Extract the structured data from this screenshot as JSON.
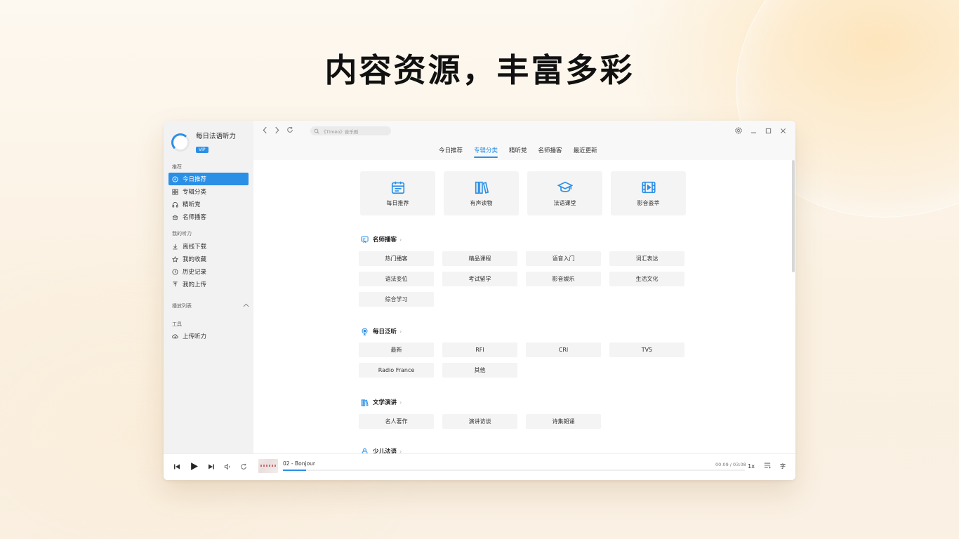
{
  "hero": {
    "title": "内容资源，丰富多彩"
  },
  "app": {
    "name": "每日法语听力",
    "vip_badge": "VIP",
    "accent_color": "#2b8fe6"
  },
  "sidebar": {
    "recommend_label": "推荐",
    "recommend_items": [
      {
        "label": "今日推荐",
        "icon": "compass-icon",
        "active": true
      },
      {
        "label": "专辑分类",
        "icon": "grid-icon",
        "active": false
      },
      {
        "label": "精听党",
        "icon": "headphones-icon",
        "active": false
      },
      {
        "label": "名师播客",
        "icon": "podcast-icon",
        "active": false
      }
    ],
    "my_label": "我的听力",
    "my_items": [
      {
        "label": "离线下载",
        "icon": "download-icon"
      },
      {
        "label": "我的收藏",
        "icon": "star-icon"
      },
      {
        "label": "历史记录",
        "icon": "clock-icon"
      },
      {
        "label": "我的上传",
        "icon": "upload-icon"
      }
    ],
    "playlist_label": "播放列表",
    "tools_label": "工具",
    "tools_items": [
      {
        "label": "上传听力",
        "icon": "cloud-upload-icon"
      }
    ]
  },
  "topbar": {
    "search_placeholder": "《Timéo》音乐剧",
    "tabs": [
      {
        "label": "今日推荐",
        "active": false
      },
      {
        "label": "专辑分类",
        "active": true
      },
      {
        "label": "精听党",
        "active": false
      },
      {
        "label": "名师播客",
        "active": false
      },
      {
        "label": "最近更新",
        "active": false
      }
    ]
  },
  "main": {
    "cards": [
      {
        "label": "每日推荐",
        "icon": "calendar-icon"
      },
      {
        "label": "有声读物",
        "icon": "books-icon"
      },
      {
        "label": "法语课堂",
        "icon": "graduation-cap-icon"
      },
      {
        "label": "影音荟萃",
        "icon": "film-icon"
      }
    ],
    "sections": [
      {
        "title": "名师播客",
        "icon": "podcast-board-icon",
        "chips": [
          "热门播客",
          "精品课程",
          "语音入门",
          "词汇表达",
          "语法变位",
          "考试留学",
          "影音娱乐",
          "生活文化",
          "综合学习"
        ]
      },
      {
        "title": "每日泛听",
        "icon": "radio-icon",
        "chips": [
          "最新",
          "RFI",
          "CRI",
          "TV5",
          "Radio France",
          "其他"
        ]
      },
      {
        "title": "文学演讲",
        "icon": "books-icon",
        "chips": [
          "名人著作",
          "演讲访谈",
          "诗集朗诵"
        ]
      },
      {
        "title": "少儿法语",
        "icon": "kids-icon",
        "chips": []
      }
    ]
  },
  "player": {
    "track": "02 - Bonjour",
    "time": "00:09 / 03:08",
    "progress": 0.05,
    "speed": "1x",
    "lyrics_label": "字"
  }
}
